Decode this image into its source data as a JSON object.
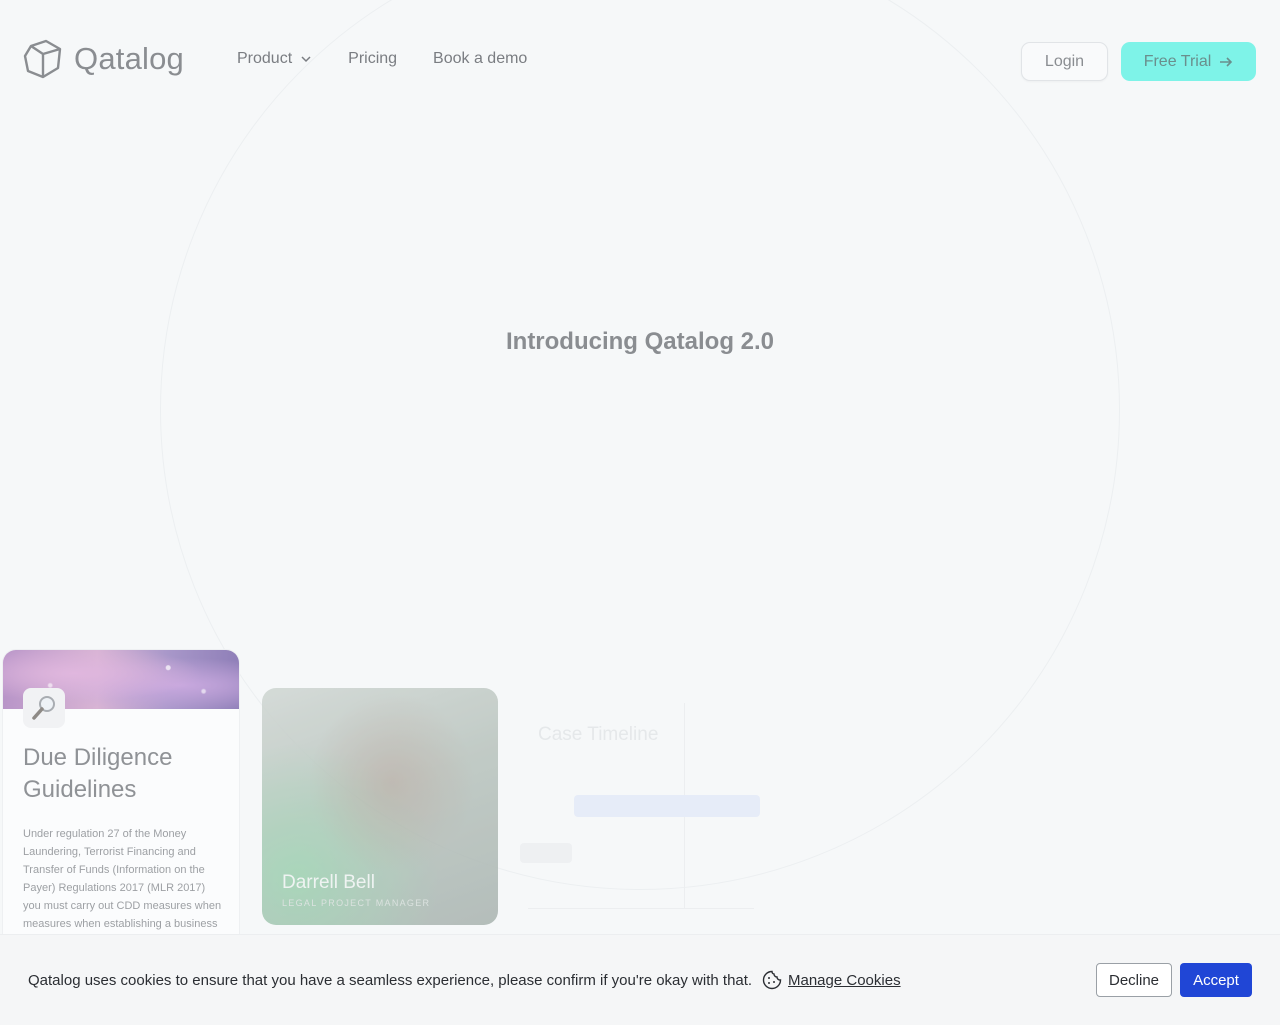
{
  "brand": {
    "name": "Qatalog"
  },
  "nav": {
    "items": [
      {
        "label": "Product",
        "has_dropdown": true
      },
      {
        "label": "Pricing"
      },
      {
        "label": "Book a demo"
      }
    ]
  },
  "header_actions": {
    "login_label": "Login",
    "trial_label": "Free Trial"
  },
  "hero": {
    "title": "Introducing Qatalog 2.0"
  },
  "cards": {
    "due_diligence": {
      "title": "Due Diligence Guidelines",
      "body": "Under regulation 27 of the Money Laundering, Terrorist Financing and Transfer of Funds (Information on the Payer) Regulations 2017 (MLR 2017) you must carry out CDD measures when measures when establishing a business"
    },
    "person": {
      "name": "Darrell Bell",
      "role": "LEGAL PROJECT MANAGER"
    },
    "timeline": {
      "title": "Case Timeline"
    }
  },
  "cookie_banner": {
    "message": "Qatalog uses cookies to ensure that you have a seamless experience, please confirm if you're okay with that.",
    "manage_label": "Manage Cookies",
    "decline_label": "Decline",
    "accept_label": "Accept"
  },
  "colors": {
    "accent_trial": "#7ef3e8",
    "accept_blue": "#2046d6",
    "background": "#f6f8f9"
  }
}
